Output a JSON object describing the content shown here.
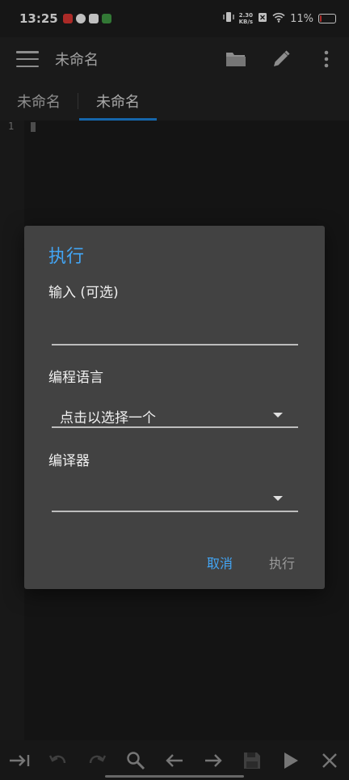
{
  "status_bar": {
    "time": "13:25",
    "net_speed_value": "2.30",
    "net_speed_unit": "KB/s",
    "battery": "11%",
    "battery_level": 0.11
  },
  "app_bar": {
    "title": "未命名"
  },
  "tabs": [
    {
      "label": "未命名"
    },
    {
      "label": "未命名"
    }
  ],
  "editor": {
    "line_number": "1"
  },
  "dialog": {
    "title": "执行",
    "input_label": "输入 (可选)",
    "input_value": "",
    "language_label": "编程语言",
    "language_value": "点击以选择一个",
    "compiler_label": "编译器",
    "compiler_value": "",
    "cancel_label": "取消",
    "execute_label": "执行"
  },
  "colors": {
    "accent": "#42a5f5",
    "tab_indicator": "#1e88e5",
    "battery_low": "#e53935"
  }
}
